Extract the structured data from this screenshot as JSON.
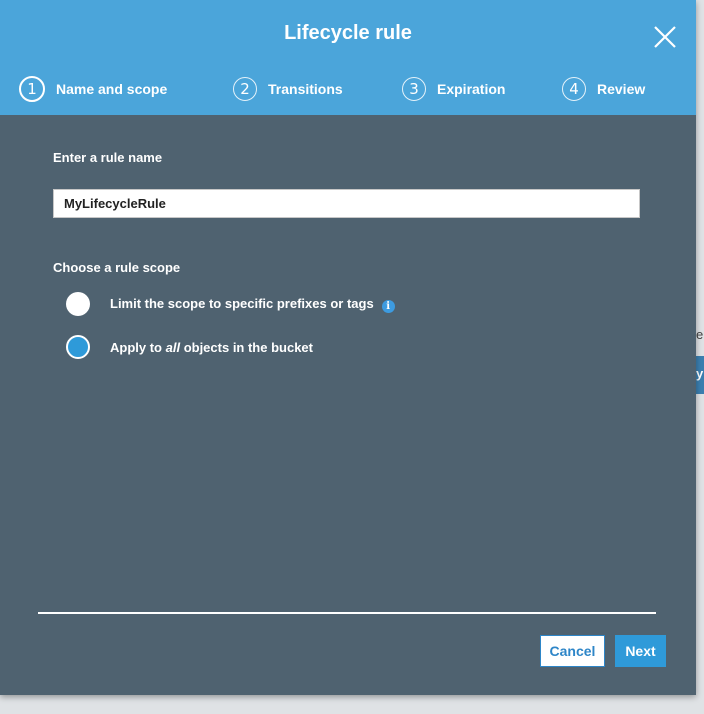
{
  "background": {
    "text_fragment": "er",
    "button_fragment": "y"
  },
  "modal": {
    "title": "Lifecycle rule",
    "close_icon": "close-icon",
    "steps": [
      {
        "number": "1",
        "label": "Name and scope",
        "active": true
      },
      {
        "number": "2",
        "label": "Transitions",
        "active": false
      },
      {
        "number": "3",
        "label": "Expiration",
        "active": false
      },
      {
        "number": "4",
        "label": "Review",
        "active": false
      }
    ],
    "rule_name": {
      "label": "Enter a rule name",
      "value": "MyLifecycleRule"
    },
    "scope": {
      "label": "Choose a rule scope",
      "options": [
        {
          "label": "Limit the scope to specific prefixes or tags",
          "selected": false,
          "has_info": true,
          "info_icon": "info-icon"
        },
        {
          "label_before": "Apply to ",
          "label_em": "all",
          "label_after": " objects in the bucket",
          "selected": true
        }
      ]
    },
    "footer": {
      "cancel_label": "Cancel",
      "next_label": "Next"
    }
  },
  "colors": {
    "header": "#4ba5da",
    "body": "#4f6270",
    "primary": "#2f9ad9",
    "info": "#3d9be0"
  }
}
